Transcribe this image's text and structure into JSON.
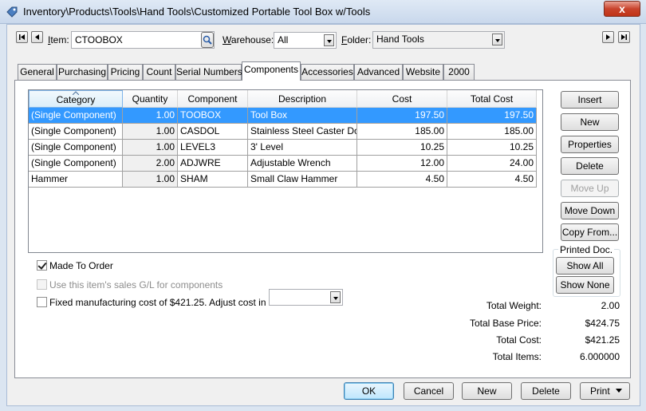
{
  "window": {
    "title": "Inventory\\Products\\Tools\\Hand Tools\\Customized Portable Tool Box w/Tools",
    "close_label": "x"
  },
  "header": {
    "item_label": "Item:",
    "item_value": "CTOOBOX",
    "warehouse_label": "Warehouse:",
    "warehouse_value": "All",
    "folder_label": "Folder:",
    "folder_value": "Hand Tools"
  },
  "tabs": [
    {
      "label": "General"
    },
    {
      "label": "Purchasing"
    },
    {
      "label": "Pricing"
    },
    {
      "label": "Count"
    },
    {
      "label": "Serial Numbers"
    },
    {
      "label": "Components",
      "active": true
    },
    {
      "label": "Accessories"
    },
    {
      "label": "Advanced"
    },
    {
      "label": "Website"
    },
    {
      "label": "2000"
    }
  ],
  "grid": {
    "columns": [
      "Category",
      "Quantity",
      "Component",
      "Description",
      "Cost",
      "Total Cost"
    ],
    "rows": [
      {
        "category": "(Single Component)",
        "quantity": "1.00",
        "component": "TOOBOX",
        "description": "Tool Box",
        "cost": "197.50",
        "total_cost": "197.50",
        "selected": true
      },
      {
        "category": "(Single Component)",
        "quantity": "1.00",
        "component": "CASDOL",
        "description": "Stainless Steel Caster Dolly",
        "cost": "185.00",
        "total_cost": "185.00"
      },
      {
        "category": "(Single Component)",
        "quantity": "1.00",
        "component": "LEVEL3",
        "description": "3' Level",
        "cost": "10.25",
        "total_cost": "10.25"
      },
      {
        "category": "(Single Component)",
        "quantity": "2.00",
        "component": "ADJWRE",
        "description": "Adjustable Wrench",
        "cost": "12.00",
        "total_cost": "24.00"
      },
      {
        "category": "Hammer",
        "quantity": "1.00",
        "component": "SHAM",
        "description": "Small Claw Hammer",
        "cost": "4.50",
        "total_cost": "4.50"
      }
    ]
  },
  "side_buttons": {
    "insert": "Insert",
    "new": "New",
    "properties": "Properties",
    "delete": "Delete",
    "move_up": "Move Up",
    "move_down": "Move Down",
    "copy_from": "Copy From...",
    "printed_doc_label": "Printed Doc.",
    "show_all": "Show All",
    "show_none": "Show None"
  },
  "options": {
    "made_to_order": "Made To Order",
    "made_to_order_checked": true,
    "use_gl": "Use this item's sales G/L for components",
    "use_gl_checked": false,
    "fixed_cost": "Fixed manufacturing cost of $421.25. Adjust cost in item:",
    "fixed_cost_checked": false
  },
  "totals": {
    "weight_label": "Total Weight:",
    "weight_value": "2.00",
    "base_price_label": "Total Base Price:",
    "base_price_value": "$424.75",
    "cost_label": "Total Cost:",
    "cost_value": "$421.25",
    "items_label": "Total Items:",
    "items_value": "6.000000"
  },
  "footer": {
    "ok": "OK",
    "cancel": "Cancel",
    "new": "New",
    "delete": "Delete",
    "print": "Print"
  }
}
